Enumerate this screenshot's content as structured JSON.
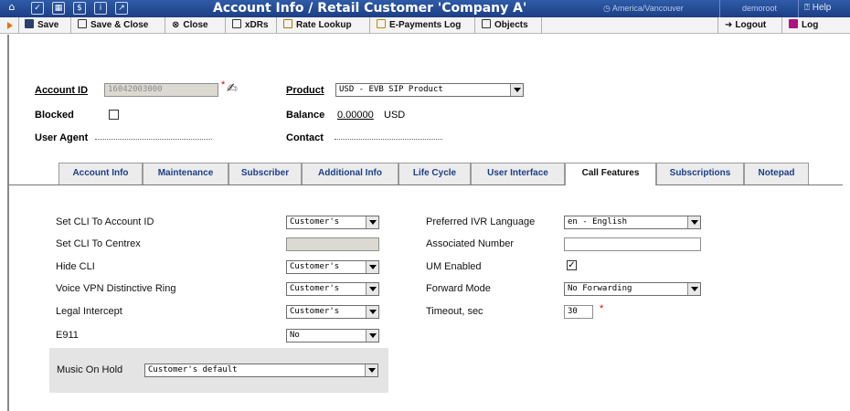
{
  "window": {
    "title": "Account Info / Retail Customer 'Company A'",
    "timezone": "America/Vancouver",
    "user": "demoroot",
    "help": "Help"
  },
  "toolbar": {
    "save": "Save",
    "save_close": "Save & Close",
    "close": "Close",
    "xdrs": "xDRs",
    "rate_lookup": "Rate Lookup",
    "epayments_log": "E-Payments Log",
    "objects": "Objects",
    "logout": "Logout",
    "log": "Log"
  },
  "header": {
    "account_id_label": "Account ID",
    "account_id_value": "16042003000",
    "required_mark": "*",
    "product_label": "Product",
    "product_value": "USD - EVB SIP Product",
    "blocked_label": "Blocked",
    "balance_label": "Balance",
    "balance_amount": "0.00000",
    "balance_currency": "USD",
    "user_agent_label": "User Agent",
    "contact_label": "Contact"
  },
  "tabs": [
    {
      "label": "Account Info"
    },
    {
      "label": "Maintenance"
    },
    {
      "label": "Subscriber"
    },
    {
      "label": "Additional Info"
    },
    {
      "label": "Life Cycle"
    },
    {
      "label": "User Interface"
    },
    {
      "label": "Call Features",
      "active": true
    },
    {
      "label": "Subscriptions"
    },
    {
      "label": "Notepad"
    }
  ],
  "call_features": {
    "left": {
      "set_cli_account_id": {
        "label": "Set CLI To Account ID",
        "value": "Customer's"
      },
      "set_cli_centrex": {
        "label": "Set CLI To Centrex",
        "value": ""
      },
      "hide_cli": {
        "label": "Hide CLI",
        "value": "Customer's"
      },
      "vpn_ring": {
        "label": "Voice VPN Distinctive Ring",
        "value": "Customer's"
      },
      "legal_intercept": {
        "label": "Legal Intercept",
        "value": "Customer's"
      },
      "e911": {
        "label": "E911",
        "value": "No"
      },
      "music_on_hold": {
        "label": "Music On Hold",
        "value": "Customer's default"
      }
    },
    "right": {
      "ivr_language": {
        "label": "Preferred IVR Language",
        "value": "en - English"
      },
      "associated_number": {
        "label": "Associated Number",
        "value": ""
      },
      "um_enabled": {
        "label": "UM Enabled",
        "checked": true,
        "mark": "✓"
      },
      "forward_mode": {
        "label": "Forward Mode",
        "value": "No Forwarding"
      },
      "timeout": {
        "label": "Timeout, sec",
        "value": "30",
        "required_mark": "*"
      }
    }
  }
}
